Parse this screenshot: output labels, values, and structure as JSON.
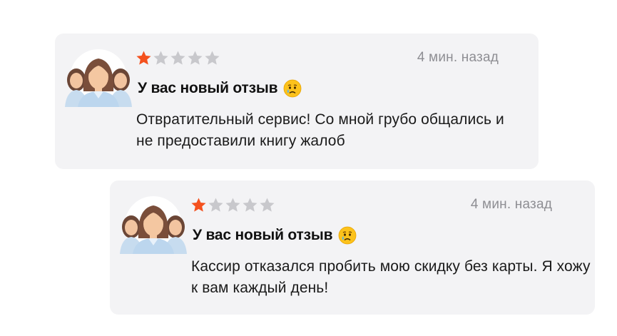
{
  "reviews": [
    {
      "rating": 1,
      "max_rating": 5,
      "time": "4 мин. назад",
      "title": "У вас новый отзыв",
      "emoji_icon": "crying-face-icon",
      "text": "Отвратительный сервис! Со мной грубо общались и не предоставили книгу жалоб"
    },
    {
      "rating": 1,
      "max_rating": 5,
      "time": "4 мин. назад",
      "title": "У вас новый отзыв",
      "emoji_icon": "crying-face-icon",
      "text": "Кассир отказался пробить мою скидку без карты. Я хожу к вам каждый день!"
    }
  ],
  "colors": {
    "card_bg": "#f3f3f5",
    "star_filled": "#f4511e",
    "star_empty": "#c8c8cc",
    "muted_text": "#8e8e93",
    "avatar_shirt": "#bcd6ee",
    "avatar_skin": "#f4c7a1",
    "avatar_hair": "#7a4e3a"
  }
}
